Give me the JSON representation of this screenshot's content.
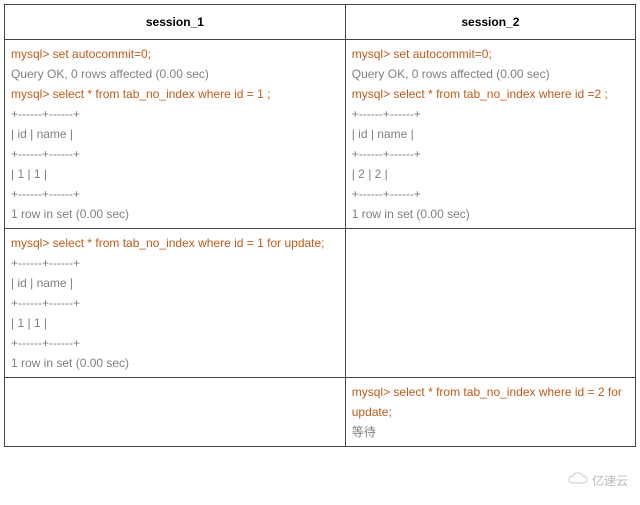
{
  "headers": {
    "col1": "session_1",
    "col2": "session_2"
  },
  "row1": {
    "left": {
      "l1": "mysql> set autocommit=0;",
      "l2": "Query OK, 0 rows affected (0.00 sec)",
      "l3": "mysql> select * from tab_no_index where id = 1 ;",
      "l4": "+------+------+",
      "l5": "| id      | name |",
      "l6": "+------+------+",
      "l7": "| 1       | 1        |",
      "l8": "+------+------+",
      "l9": "1 row in set (0.00 sec)"
    },
    "right": {
      "l1": "mysql> set autocommit=0;",
      "l2": "Query OK, 0 rows affected (0.00 sec)",
      "l3": "mysql> select * from tab_no_index where id =2 ;",
      "l4": "+------+------+",
      "l5": "| id      | name |",
      "l6": "+------+------+",
      "l7": "| 2       | 2        |",
      "l8": "+------+------+",
      "l9": "1 row in set (0.00 sec)"
    }
  },
  "row2": {
    "left": {
      "l1": "mysql> select * from tab_no_index where id = 1 for update;",
      "l2": "+------+------+",
      "l3": "| id      | name |",
      "l4": "+------+------+",
      "l5": "| 1       | 1        |",
      "l6": "+------+------+",
      "l7": "1 row in set (0.00 sec)"
    },
    "right": ""
  },
  "row3": {
    "left": "",
    "right": {
      "l1": "mysql> select * from tab_no_index where id = 2 for update;",
      "l2": "等待"
    }
  },
  "watermark": "亿速云"
}
